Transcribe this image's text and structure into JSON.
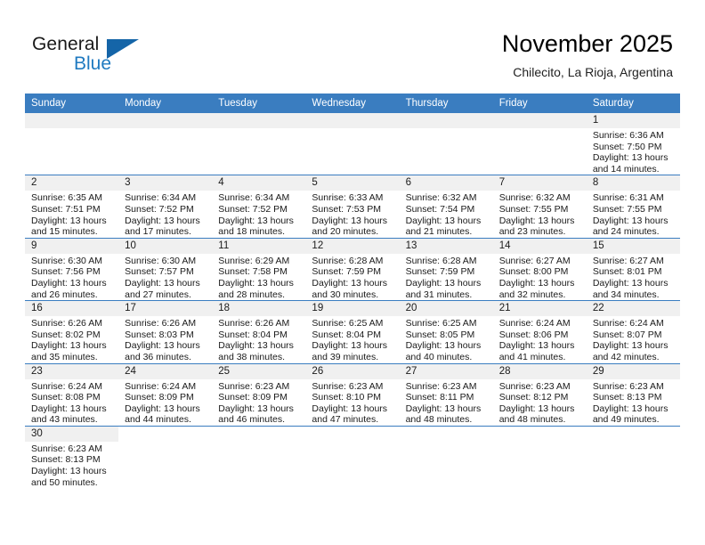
{
  "brand": {
    "name_top": "General",
    "name_bottom": "Blue",
    "accent_color": "#1565a8",
    "text_color": "#1a1a1a"
  },
  "header": {
    "title": "November 2025",
    "subtitle": "Chilecito, La Rioja, Argentina",
    "header_bg": "#3a7dc0"
  },
  "weekdays": [
    "Sunday",
    "Monday",
    "Tuesday",
    "Wednesday",
    "Thursday",
    "Friday",
    "Saturday"
  ],
  "weeks": [
    [
      {
        "day": "",
        "sunrise": "",
        "sunset": "",
        "daylight": "",
        "empty": true
      },
      {
        "day": "",
        "sunrise": "",
        "sunset": "",
        "daylight": "",
        "empty": true
      },
      {
        "day": "",
        "sunrise": "",
        "sunset": "",
        "daylight": "",
        "empty": true
      },
      {
        "day": "",
        "sunrise": "",
        "sunset": "",
        "daylight": "",
        "empty": true
      },
      {
        "day": "",
        "sunrise": "",
        "sunset": "",
        "daylight": "",
        "empty": true
      },
      {
        "day": "",
        "sunrise": "",
        "sunset": "",
        "daylight": "",
        "empty": true
      },
      {
        "day": "1",
        "sunrise": "Sunrise: 6:36 AM",
        "sunset": "Sunset: 7:50 PM",
        "daylight": "Daylight: 13 hours and 14 minutes."
      }
    ],
    [
      {
        "day": "2",
        "sunrise": "Sunrise: 6:35 AM",
        "sunset": "Sunset: 7:51 PM",
        "daylight": "Daylight: 13 hours and 15 minutes."
      },
      {
        "day": "3",
        "sunrise": "Sunrise: 6:34 AM",
        "sunset": "Sunset: 7:52 PM",
        "daylight": "Daylight: 13 hours and 17 minutes."
      },
      {
        "day": "4",
        "sunrise": "Sunrise: 6:34 AM",
        "sunset": "Sunset: 7:52 PM",
        "daylight": "Daylight: 13 hours and 18 minutes."
      },
      {
        "day": "5",
        "sunrise": "Sunrise: 6:33 AM",
        "sunset": "Sunset: 7:53 PM",
        "daylight": "Daylight: 13 hours and 20 minutes."
      },
      {
        "day": "6",
        "sunrise": "Sunrise: 6:32 AM",
        "sunset": "Sunset: 7:54 PM",
        "daylight": "Daylight: 13 hours and 21 minutes."
      },
      {
        "day": "7",
        "sunrise": "Sunrise: 6:32 AM",
        "sunset": "Sunset: 7:55 PM",
        "daylight": "Daylight: 13 hours and 23 minutes."
      },
      {
        "day": "8",
        "sunrise": "Sunrise: 6:31 AM",
        "sunset": "Sunset: 7:55 PM",
        "daylight": "Daylight: 13 hours and 24 minutes."
      }
    ],
    [
      {
        "day": "9",
        "sunrise": "Sunrise: 6:30 AM",
        "sunset": "Sunset: 7:56 PM",
        "daylight": "Daylight: 13 hours and 26 minutes."
      },
      {
        "day": "10",
        "sunrise": "Sunrise: 6:30 AM",
        "sunset": "Sunset: 7:57 PM",
        "daylight": "Daylight: 13 hours and 27 minutes."
      },
      {
        "day": "11",
        "sunrise": "Sunrise: 6:29 AM",
        "sunset": "Sunset: 7:58 PM",
        "daylight": "Daylight: 13 hours and 28 minutes."
      },
      {
        "day": "12",
        "sunrise": "Sunrise: 6:28 AM",
        "sunset": "Sunset: 7:59 PM",
        "daylight": "Daylight: 13 hours and 30 minutes."
      },
      {
        "day": "13",
        "sunrise": "Sunrise: 6:28 AM",
        "sunset": "Sunset: 7:59 PM",
        "daylight": "Daylight: 13 hours and 31 minutes."
      },
      {
        "day": "14",
        "sunrise": "Sunrise: 6:27 AM",
        "sunset": "Sunset: 8:00 PM",
        "daylight": "Daylight: 13 hours and 32 minutes."
      },
      {
        "day": "15",
        "sunrise": "Sunrise: 6:27 AM",
        "sunset": "Sunset: 8:01 PM",
        "daylight": "Daylight: 13 hours and 34 minutes."
      }
    ],
    [
      {
        "day": "16",
        "sunrise": "Sunrise: 6:26 AM",
        "sunset": "Sunset: 8:02 PM",
        "daylight": "Daylight: 13 hours and 35 minutes."
      },
      {
        "day": "17",
        "sunrise": "Sunrise: 6:26 AM",
        "sunset": "Sunset: 8:03 PM",
        "daylight": "Daylight: 13 hours and 36 minutes."
      },
      {
        "day": "18",
        "sunrise": "Sunrise: 6:26 AM",
        "sunset": "Sunset: 8:04 PM",
        "daylight": "Daylight: 13 hours and 38 minutes."
      },
      {
        "day": "19",
        "sunrise": "Sunrise: 6:25 AM",
        "sunset": "Sunset: 8:04 PM",
        "daylight": "Daylight: 13 hours and 39 minutes."
      },
      {
        "day": "20",
        "sunrise": "Sunrise: 6:25 AM",
        "sunset": "Sunset: 8:05 PM",
        "daylight": "Daylight: 13 hours and 40 minutes."
      },
      {
        "day": "21",
        "sunrise": "Sunrise: 6:24 AM",
        "sunset": "Sunset: 8:06 PM",
        "daylight": "Daylight: 13 hours and 41 minutes."
      },
      {
        "day": "22",
        "sunrise": "Sunrise: 6:24 AM",
        "sunset": "Sunset: 8:07 PM",
        "daylight": "Daylight: 13 hours and 42 minutes."
      }
    ],
    [
      {
        "day": "23",
        "sunrise": "Sunrise: 6:24 AM",
        "sunset": "Sunset: 8:08 PM",
        "daylight": "Daylight: 13 hours and 43 minutes."
      },
      {
        "day": "24",
        "sunrise": "Sunrise: 6:24 AM",
        "sunset": "Sunset: 8:09 PM",
        "daylight": "Daylight: 13 hours and 44 minutes."
      },
      {
        "day": "25",
        "sunrise": "Sunrise: 6:23 AM",
        "sunset": "Sunset: 8:09 PM",
        "daylight": "Daylight: 13 hours and 46 minutes."
      },
      {
        "day": "26",
        "sunrise": "Sunrise: 6:23 AM",
        "sunset": "Sunset: 8:10 PM",
        "daylight": "Daylight: 13 hours and 47 minutes."
      },
      {
        "day": "27",
        "sunrise": "Sunrise: 6:23 AM",
        "sunset": "Sunset: 8:11 PM",
        "daylight": "Daylight: 13 hours and 48 minutes."
      },
      {
        "day": "28",
        "sunrise": "Sunrise: 6:23 AM",
        "sunset": "Sunset: 8:12 PM",
        "daylight": "Daylight: 13 hours and 48 minutes."
      },
      {
        "day": "29",
        "sunrise": "Sunrise: 6:23 AM",
        "sunset": "Sunset: 8:13 PM",
        "daylight": "Daylight: 13 hours and 49 minutes."
      }
    ],
    [
      {
        "day": "30",
        "sunrise": "Sunrise: 6:23 AM",
        "sunset": "Sunset: 8:13 PM",
        "daylight": "Daylight: 13 hours and 50 minutes."
      },
      {
        "day": "",
        "sunrise": "",
        "sunset": "",
        "daylight": "",
        "blank": true
      },
      {
        "day": "",
        "sunrise": "",
        "sunset": "",
        "daylight": "",
        "blank": true
      },
      {
        "day": "",
        "sunrise": "",
        "sunset": "",
        "daylight": "",
        "blank": true
      },
      {
        "day": "",
        "sunrise": "",
        "sunset": "",
        "daylight": "",
        "blank": true
      },
      {
        "day": "",
        "sunrise": "",
        "sunset": "",
        "daylight": "",
        "blank": true
      },
      {
        "day": "",
        "sunrise": "",
        "sunset": "",
        "daylight": "",
        "blank": true
      }
    ]
  ]
}
